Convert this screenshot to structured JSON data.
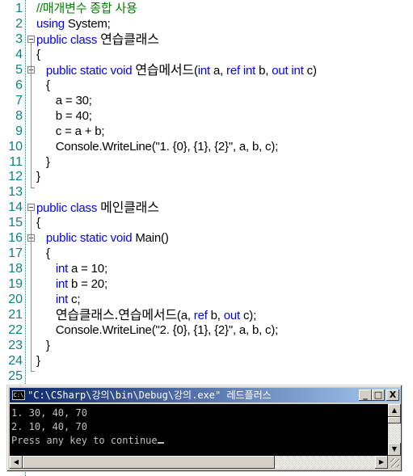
{
  "editor": {
    "lines": [
      {
        "n": "1",
        "parts": [
          {
            "t": "//매개변수 종합 사용",
            "c": "cm"
          }
        ]
      },
      {
        "n": "2",
        "parts": [
          {
            "t": "using ",
            "c": "kw"
          },
          {
            "t": "System;",
            "c": ""
          }
        ]
      },
      {
        "n": "3",
        "parts": [
          {
            "t": "public class ",
            "c": "kw"
          },
          {
            "t": "연습클래스",
            "c": "ko"
          }
        ]
      },
      {
        "n": "4",
        "parts": [
          {
            "t": "{",
            "c": ""
          }
        ]
      },
      {
        "n": "5",
        "parts": [
          {
            "t": "   public static void ",
            "c": "kw"
          },
          {
            "t": "연습메서드",
            "c": "ko"
          },
          {
            "t": "(",
            "c": ""
          },
          {
            "t": "int ",
            "c": "kw"
          },
          {
            "t": "a, ",
            "c": ""
          },
          {
            "t": "ref int ",
            "c": "kw"
          },
          {
            "t": "b, ",
            "c": ""
          },
          {
            "t": "out int ",
            "c": "kw"
          },
          {
            "t": "c)",
            "c": ""
          }
        ]
      },
      {
        "n": "6",
        "parts": [
          {
            "t": "   {",
            "c": ""
          }
        ]
      },
      {
        "n": "7",
        "parts": [
          {
            "t": "      a = 30;",
            "c": ""
          }
        ]
      },
      {
        "n": "8",
        "parts": [
          {
            "t": "      b = 40;",
            "c": ""
          }
        ]
      },
      {
        "n": "9",
        "parts": [
          {
            "t": "      c = a + b;",
            "c": ""
          }
        ]
      },
      {
        "n": "10",
        "parts": [
          {
            "t": "      Console.WriteLine(\"1. {0}, {1}, {2}\", a, b, c);",
            "c": ""
          }
        ]
      },
      {
        "n": "11",
        "parts": [
          {
            "t": "   }",
            "c": ""
          }
        ]
      },
      {
        "n": "12",
        "parts": [
          {
            "t": "}",
            "c": ""
          }
        ]
      },
      {
        "n": "13",
        "parts": []
      },
      {
        "n": "14",
        "parts": [
          {
            "t": "public class ",
            "c": "kw"
          },
          {
            "t": "메인클래스",
            "c": "ko"
          }
        ]
      },
      {
        "n": "15",
        "parts": [
          {
            "t": "{",
            "c": ""
          }
        ]
      },
      {
        "n": "16",
        "parts": [
          {
            "t": "   public static void ",
            "c": "kw"
          },
          {
            "t": "Main()",
            "c": ""
          }
        ]
      },
      {
        "n": "17",
        "parts": [
          {
            "t": "   {",
            "c": ""
          }
        ]
      },
      {
        "n": "18",
        "parts": [
          {
            "t": "      ",
            "c": ""
          },
          {
            "t": "int ",
            "c": "kw"
          },
          {
            "t": "a = 10;",
            "c": ""
          }
        ]
      },
      {
        "n": "19",
        "parts": [
          {
            "t": "      ",
            "c": ""
          },
          {
            "t": "int ",
            "c": "kw"
          },
          {
            "t": "b = 20;",
            "c": ""
          }
        ]
      },
      {
        "n": "20",
        "parts": [
          {
            "t": "      ",
            "c": ""
          },
          {
            "t": "int ",
            "c": "kw"
          },
          {
            "t": "c;",
            "c": ""
          }
        ]
      },
      {
        "n": "21",
        "parts": [
          {
            "t": "      ",
            "c": ""
          },
          {
            "t": "연습클래스.연습메서드",
            "c": "ko"
          },
          {
            "t": "(a, ",
            "c": ""
          },
          {
            "t": "ref ",
            "c": "kw"
          },
          {
            "t": "b, ",
            "c": ""
          },
          {
            "t": "out ",
            "c": "kw"
          },
          {
            "t": "c);",
            "c": ""
          }
        ]
      },
      {
        "n": "22",
        "parts": [
          {
            "t": "      Console.WriteLine(\"2. {0}, {1}, {2}\", a, b, c);",
            "c": ""
          }
        ]
      },
      {
        "n": "23",
        "parts": [
          {
            "t": "   }",
            "c": ""
          }
        ]
      },
      {
        "n": "24",
        "parts": [
          {
            "t": "}",
            "c": ""
          }
        ]
      },
      {
        "n": "25",
        "parts": []
      }
    ],
    "fold_lines": [
      "3",
      "5",
      "14",
      "16"
    ]
  },
  "console": {
    "icon_label": "C:\\",
    "title": "\"C:\\CSharp\\강의\\bin\\Debug\\강의.exe\" 레드플러스",
    "buttons": {
      "minimize": "_",
      "maximize": "□",
      "close": "X"
    },
    "output": [
      "1. 30, 40, 70",
      "2. 10, 40, 70",
      "Press any key to continue"
    ],
    "scroll": {
      "up": "▲",
      "down": "▼",
      "left": "◀",
      "right": "▶"
    }
  },
  "colors": {
    "keyword": "#0000ff",
    "comment": "#008000",
    "line_number": "#0c8282",
    "titlebar_start": "#0a246a",
    "titlebar_end": "#a6caf0"
  }
}
